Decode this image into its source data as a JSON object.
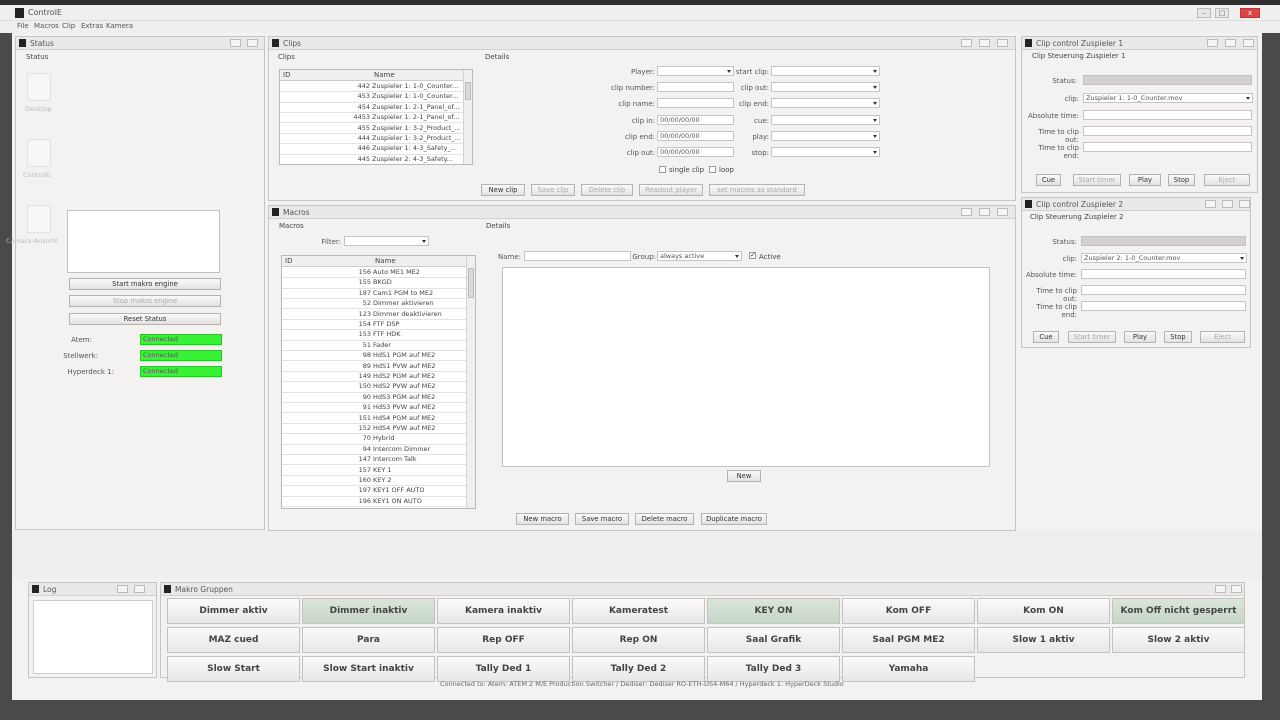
{
  "app": {
    "title": "ControlE",
    "menu": [
      "File",
      "Macros",
      "Clip",
      "Extras",
      "Kamera"
    ]
  },
  "status_panel": {
    "title": "Status",
    "subtitle": "Status",
    "icons": [
      {
        "label": "Desktop"
      },
      {
        "label": "ControlE"
      },
      {
        "label": "Cámara-Ansicht"
      }
    ],
    "buttons": {
      "start": "Start makro engine",
      "stop": "Stop makro engine",
      "reset": "Reset Status"
    },
    "connections": [
      {
        "label": "Atem:",
        "value": "Connected"
      },
      {
        "label": "Stellwerk:",
        "value": "Connected"
      },
      {
        "label": "Hyperdeck 1:",
        "value": "Connected"
      }
    ]
  },
  "clips_panel": {
    "title": "Clips",
    "list_title": "Clips",
    "details_title": "Details",
    "columns": [
      "ID",
      "Name"
    ],
    "rows": [
      {
        "id": "442",
        "name": "Zuspieler 1: 1-0_Counter..."
      },
      {
        "id": "453",
        "name": "Zuspieler 1: 1-0_Counter..."
      },
      {
        "id": "454",
        "name": "Zuspieler 1: 2-1_Panel_of..."
      },
      {
        "id": "4453",
        "name": "Zuspieler 1: 2-1_Panel_of..."
      },
      {
        "id": "455",
        "name": "Zuspieler 1: 3-2_Product_..."
      },
      {
        "id": "444",
        "name": "Zuspieler 1: 3-2_Product_..."
      },
      {
        "id": "446",
        "name": "Zuspieler 1: 4-3_Safety_..."
      },
      {
        "id": "445",
        "name": "Zuspieler 2: 4-3_Safety..."
      }
    ],
    "labels": {
      "player": "Player:",
      "clip_number": "clip number:",
      "clip_name": "clip name:",
      "clip_in": "clip in:",
      "clip_end": "clip end:",
      "clip_out": "clip out:",
      "start_clip": "start clip:",
      "clip_out2": "clip out:",
      "clip_end2": "clip end:",
      "cue": "cue:",
      "play": "play:",
      "stop": "stop:"
    },
    "values": {
      "clip_in": "00/00/00/00",
      "clip_end": "00/00/00/00",
      "clip_out": "00/00/00/00"
    },
    "checks": {
      "single": "single clip",
      "loop": "loop"
    },
    "buttons": [
      "New clip",
      "Save clip",
      "Delete clip",
      "Readout player",
      "set macros as standard"
    ]
  },
  "macros_panel": {
    "title": "Macros",
    "list_title": "Macros",
    "details_title": "Details",
    "filter_label": "Filter:",
    "columns": [
      "ID",
      "Name"
    ],
    "rows": [
      {
        "id": "156",
        "name": "Auto ME1 ME2"
      },
      {
        "id": "155",
        "name": "BKGD"
      },
      {
        "id": "187",
        "name": "Cam1 PGM to ME2"
      },
      {
        "id": "52",
        "name": "Dimmer aktivieren"
      },
      {
        "id": "123",
        "name": "Dimmer deaktivieren"
      },
      {
        "id": "154",
        "name": "FTF DSP"
      },
      {
        "id": "153",
        "name": "FTF HDK"
      },
      {
        "id": "51",
        "name": "Fader"
      },
      {
        "id": "98",
        "name": "HdS1 PGM auf ME2"
      },
      {
        "id": "89",
        "name": "HdS1 PVW auf ME2"
      },
      {
        "id": "149",
        "name": "HdS2 PGM auf ME2"
      },
      {
        "id": "150",
        "name": "HdS2 PVW auf ME2"
      },
      {
        "id": "90",
        "name": "HdS3 PGM auf ME2"
      },
      {
        "id": "91",
        "name": "HdS3 PVW auf ME2"
      },
      {
        "id": "151",
        "name": "HdS4 PGM auf ME2"
      },
      {
        "id": "152",
        "name": "HdS4 PVW auf ME2"
      },
      {
        "id": "70",
        "name": "Hybrid"
      },
      {
        "id": "94",
        "name": "Intercom Dimmer"
      },
      {
        "id": "147",
        "name": "Intercom Talk"
      },
      {
        "id": "157",
        "name": "KEY 1"
      },
      {
        "id": "160",
        "name": "KEY 2"
      },
      {
        "id": "197",
        "name": "KEY1 OFF AUTO"
      },
      {
        "id": "196",
        "name": "KEY1 ON AUTO"
      }
    ],
    "name_label": "Name:",
    "group_label": "Group:",
    "group_value": "always active",
    "active_label": "Active",
    "new_btn": "New",
    "buttons": [
      "New macro",
      "Save macro",
      "Delete macro",
      "Duplicate macro"
    ]
  },
  "clip_control_1": {
    "title": "Clip control Zuspieler 1",
    "subtitle": "Clip Steuerung Zuspieler 1",
    "labels": {
      "status": "Status:",
      "clip": "clip:",
      "absolute": "Absolute time:",
      "to_out": "Time to clip out:",
      "to_end": "Time to clip end:"
    },
    "clip_value": "Zuspieler 1: 1-0_Counter.mov",
    "buttons": [
      "Cue",
      "Start timer",
      "Play",
      "Stop",
      "Eject"
    ]
  },
  "clip_control_2": {
    "title": "Clip control Zuspieler 2",
    "subtitle": "Clip Steuerung Zuspieler 2",
    "labels": {
      "status": "Status:",
      "clip": "clip:",
      "absolute": "Absolute time:",
      "to_out": "Time to clip out:",
      "to_end": "Time to clip end:"
    },
    "clip_value": "Zuspieler 2: 1-0_Counter.mov",
    "buttons": [
      "Cue",
      "Start timer",
      "Play",
      "Stop",
      "Eject"
    ]
  },
  "log_panel": {
    "title": "Log"
  },
  "macro_groups": {
    "title": "Makro Gruppen",
    "buttons": [
      [
        "Dimmer aktiv",
        "Dimmer inaktiv",
        "Kamera inaktiv",
        "Kameratest",
        "KEY ON",
        "Kom OFF",
        "Kom ON",
        "Kom Off nicht gesperrt"
      ],
      [
        "MAZ cued",
        "Para",
        "Rep OFF",
        "Rep ON",
        "Saal Grafik",
        "Saal PGM ME2",
        "Slow 1 aktiv",
        "Slow 2 aktiv"
      ],
      [
        "Slow Start",
        "Slow Start inaktiv",
        "Tally Ded 1",
        "Tally Ded 2",
        "Tally Ded 3",
        "Yamaha"
      ]
    ]
  },
  "footer": "Connected to: Atem: ATEM 2 M/E Production Switcher / Dediser: Dediser RO-ETH-DS4-M64 / Hyperdeck 1: HyperDeck Studio"
}
